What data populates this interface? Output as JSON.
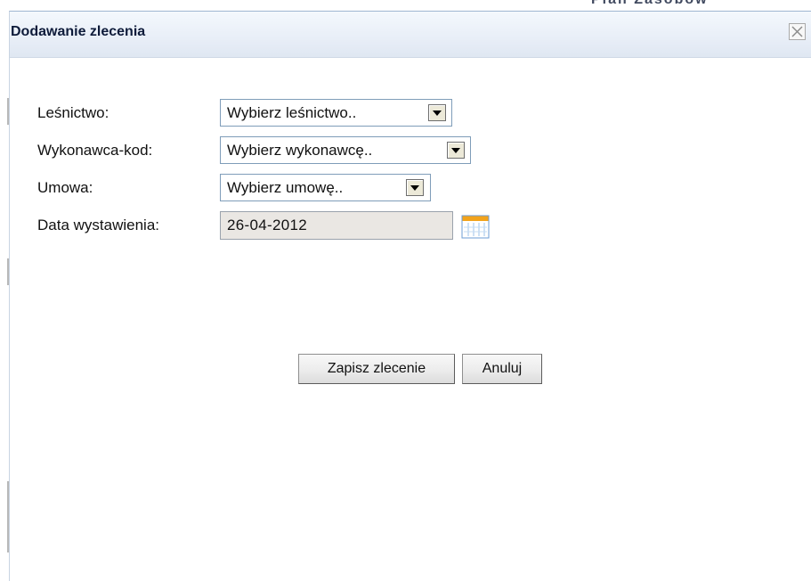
{
  "background": {
    "partial_header_text": "Plan Zasobów"
  },
  "dialog": {
    "title": "Dodawanie zlecenia",
    "close_icon": "close-x-icon"
  },
  "form": {
    "lesnictwo": {
      "label": "Leśnictwo:",
      "selected": "Wybierz leśnictwo.."
    },
    "wykonawca": {
      "label": "Wykonawca-kod:",
      "selected": "Wybierz wykonawcę.."
    },
    "umowa": {
      "label": "Umowa:",
      "selected": "Wybierz umowę.."
    },
    "data_wystawienia": {
      "label": "Data wystawienia:",
      "value": "26-04-2012",
      "icon": "calendar-icon"
    }
  },
  "buttons": {
    "save_label": "Zapisz zlecenie",
    "cancel_label": "Anuluj"
  },
  "colors": {
    "titlebar_gradient_top": "#f4f8fd",
    "titlebar_gradient_bottom": "#dfe7f2",
    "select_border": "#7f9db9",
    "date_input_bg": "#eae7e3",
    "calendar_accent": "#f2a31b"
  }
}
